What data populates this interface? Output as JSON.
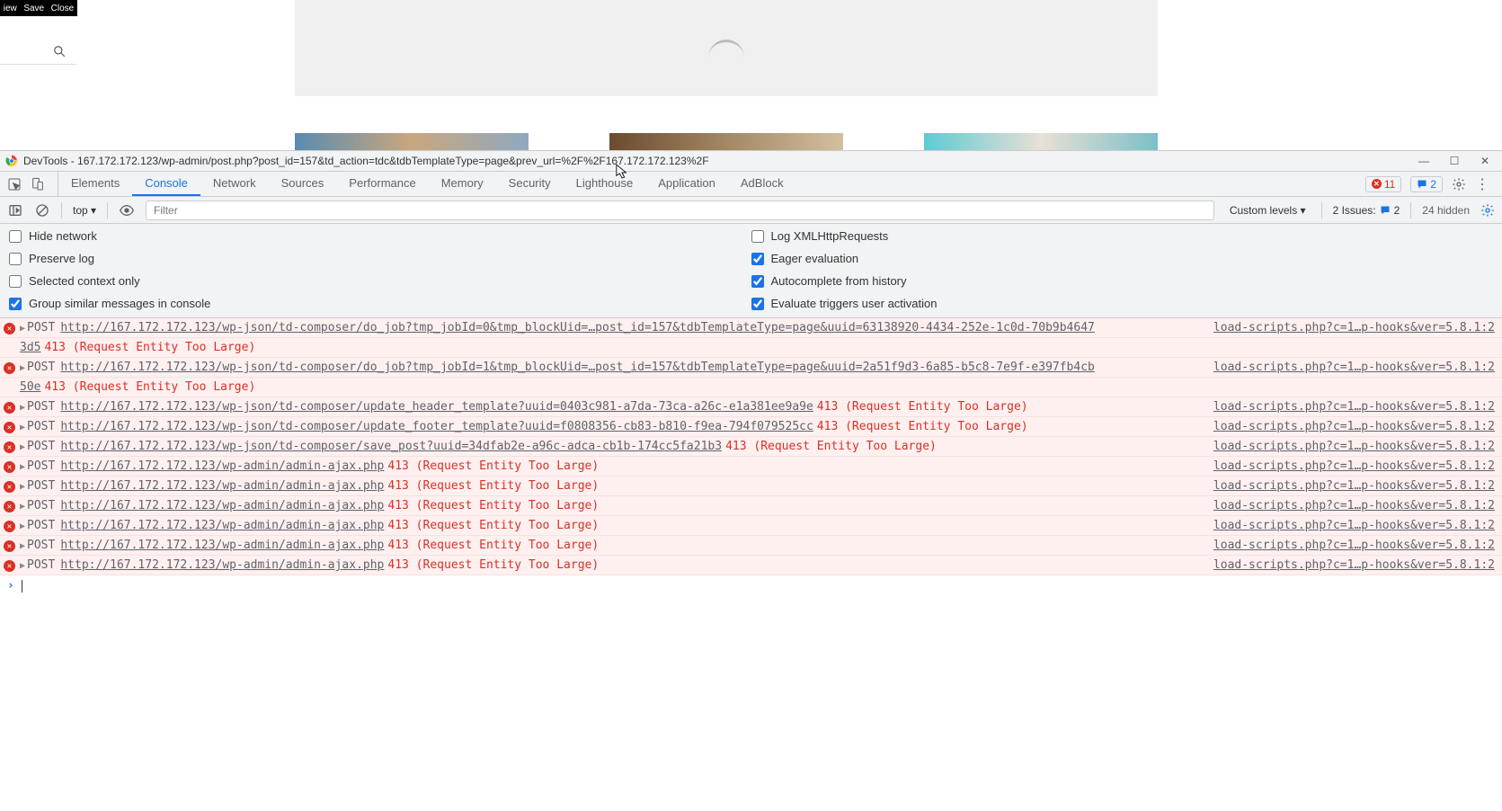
{
  "editor": {
    "toolbar": {
      "view": "iew",
      "save": "Save",
      "close": "Close"
    }
  },
  "devtools": {
    "title": "DevTools - 167.172.172.123/wp-admin/post.php?post_id=157&td_action=tdc&tdbTemplateType=page&prev_url=%2F%2F167.172.172.123%2F",
    "tabs": [
      "Elements",
      "Console",
      "Network",
      "Sources",
      "Performance",
      "Memory",
      "Security",
      "Lighthouse",
      "Application",
      "AdBlock"
    ],
    "active_tab": "Console",
    "error_count": "11",
    "warn_count": "2",
    "filterbar": {
      "context": "top ▾",
      "filter_placeholder": "Filter",
      "levels": "Custom levels ▾",
      "issues_label": "2 Issues:",
      "issues_count": "2",
      "hidden": "24 hidden"
    },
    "options": {
      "left": [
        {
          "label": "Hide network",
          "checked": false
        },
        {
          "label": "Preserve log",
          "checked": false
        },
        {
          "label": "Selected context only",
          "checked": false
        },
        {
          "label": "Group similar messages in console",
          "checked": true
        }
      ],
      "right": [
        {
          "label": "Log XMLHttpRequests",
          "checked": false
        },
        {
          "label": "Eager evaluation",
          "checked": true
        },
        {
          "label": "Autocomplete from history",
          "checked": true
        },
        {
          "label": "Evaluate triggers user activation",
          "checked": true
        }
      ]
    },
    "messages": [
      {
        "method": "POST",
        "url": "http://167.172.172.123/wp-json/td-composer/do_job?tmp_jobId=0&tmp_blockUid=…post_id=157&tdbTemplateType=page&uuid=63138920-4434-252e-1c0d-70b9b4647",
        "cont": "3d5",
        "status": "413 (Request Entity Too Large)",
        "source": "load-scripts.php?c=1…p-hooks&ver=5.8.1:2"
      },
      {
        "method": "POST",
        "url": "http://167.172.172.123/wp-json/td-composer/do_job?tmp_jobId=1&tmp_blockUid=…post_id=157&tdbTemplateType=page&uuid=2a51f9d3-6a85-b5c8-7e9f-e397fb4cb",
        "cont": "50e",
        "status": "413 (Request Entity Too Large)",
        "source": "load-scripts.php?c=1…p-hooks&ver=5.8.1:2"
      },
      {
        "method": "POST",
        "url": "http://167.172.172.123/wp-json/td-composer/update_header_template?uuid=0403c981-a7da-73ca-a26c-e1a381ee9a9e",
        "status": "413 (Request Entity Too Large)",
        "source": "load-scripts.php?c=1…p-hooks&ver=5.8.1:2"
      },
      {
        "method": "POST",
        "url": "http://167.172.172.123/wp-json/td-composer/update_footer_template?uuid=f0808356-cb83-b810-f9ea-794f079525cc",
        "status": "413 (Request Entity Too Large)",
        "source": "load-scripts.php?c=1…p-hooks&ver=5.8.1:2"
      },
      {
        "method": "POST",
        "url": "http://167.172.172.123/wp-json/td-composer/save_post?uuid=34dfab2e-a96c-adca-cb1b-174cc5fa21b3",
        "status": "413 (Request Entity Too Large)",
        "source": "load-scripts.php?c=1…p-hooks&ver=5.8.1:2"
      },
      {
        "method": "POST",
        "url": "http://167.172.172.123/wp-admin/admin-ajax.php",
        "status": "413 (Request Entity Too Large)",
        "source": "load-scripts.php?c=1…p-hooks&ver=5.8.1:2"
      },
      {
        "method": "POST",
        "url": "http://167.172.172.123/wp-admin/admin-ajax.php",
        "status": "413 (Request Entity Too Large)",
        "source": "load-scripts.php?c=1…p-hooks&ver=5.8.1:2"
      },
      {
        "method": "POST",
        "url": "http://167.172.172.123/wp-admin/admin-ajax.php",
        "status": "413 (Request Entity Too Large)",
        "source": "load-scripts.php?c=1…p-hooks&ver=5.8.1:2"
      },
      {
        "method": "POST",
        "url": "http://167.172.172.123/wp-admin/admin-ajax.php",
        "status": "413 (Request Entity Too Large)",
        "source": "load-scripts.php?c=1…p-hooks&ver=5.8.1:2"
      },
      {
        "method": "POST",
        "url": "http://167.172.172.123/wp-admin/admin-ajax.php",
        "status": "413 (Request Entity Too Large)",
        "source": "load-scripts.php?c=1…p-hooks&ver=5.8.1:2"
      },
      {
        "method": "POST",
        "url": "http://167.172.172.123/wp-admin/admin-ajax.php",
        "status": "413 (Request Entity Too Large)",
        "source": "load-scripts.php?c=1…p-hooks&ver=5.8.1:2"
      }
    ]
  }
}
